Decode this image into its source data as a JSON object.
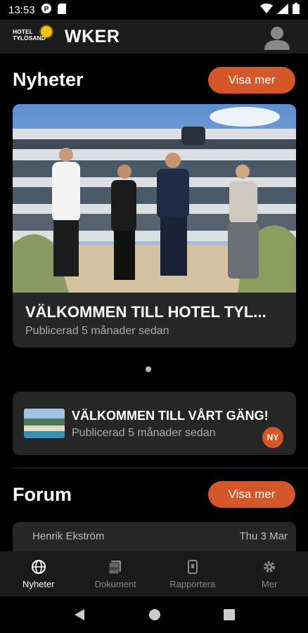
{
  "status": {
    "time": "13:53"
  },
  "appbar": {
    "logo_text": "HOTEL\nTYLÖSAND",
    "title": "WKER"
  },
  "news": {
    "heading": "Nyheter",
    "more_label": "Visa mer",
    "featured": {
      "title": "VÄLKOMMEN TILL HOTEL TYL...",
      "subtitle": "Publicerad 5 månader sedan"
    },
    "item": {
      "title": "VÄLKOMMEN TILL VÅRT GÄNG!",
      "subtitle": "Publicerad 5 månader sedan",
      "badge": "NY"
    }
  },
  "forum": {
    "heading": "Forum",
    "more_label": "Visa mer",
    "first": {
      "author": "Henrik Ekström",
      "date": "Thu 3 Mar"
    }
  },
  "nav": [
    {
      "label": "Nyheter",
      "icon": "globe-icon",
      "active": true
    },
    {
      "label": "Dokument",
      "icon": "document-icon",
      "active": false
    },
    {
      "label": "Rapportera",
      "icon": "report-icon",
      "active": false
    },
    {
      "label": "Mer",
      "icon": "gear-icon",
      "active": false
    }
  ],
  "colors": {
    "accent": "#d4572a",
    "card": "#262626",
    "background": "#000000"
  }
}
